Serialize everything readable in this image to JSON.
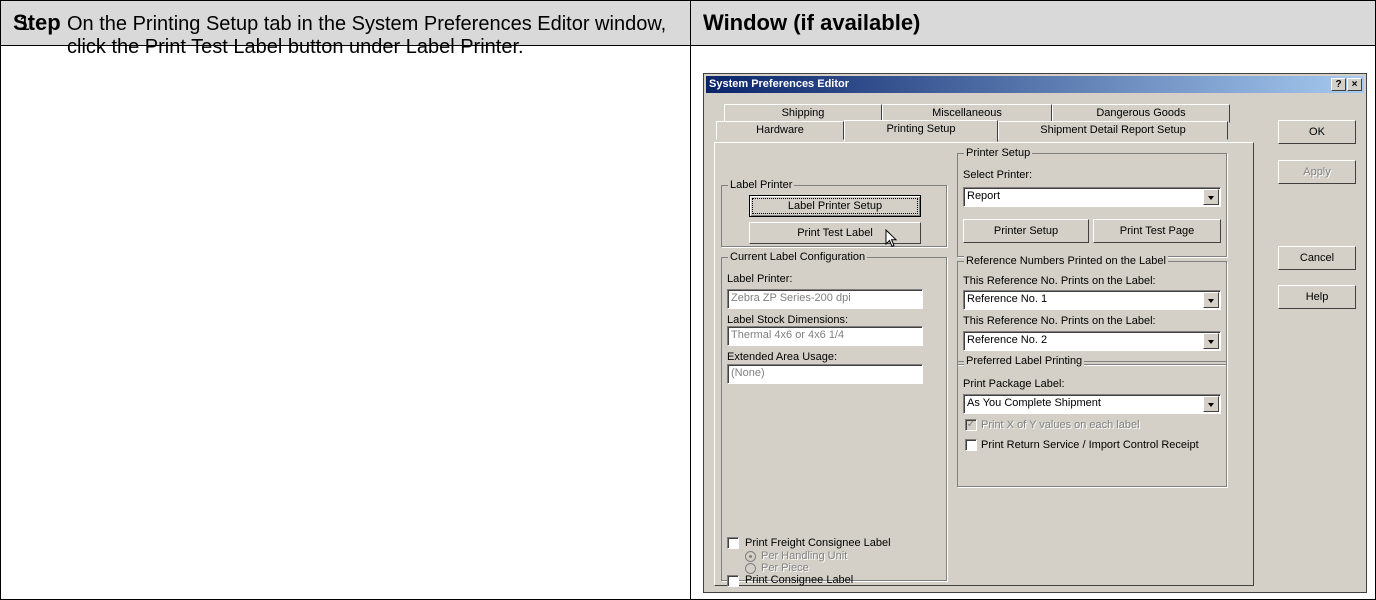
{
  "table": {
    "header_step": "Step",
    "header_window": "Window (if available)",
    "step_number": "1.",
    "step_text": "On the Printing Setup tab in the System Preferences Editor window, click the Print Test Label button under Label Printer."
  },
  "dialog": {
    "title": "System Preferences Editor",
    "help_btn": "?",
    "close_btn": "×",
    "tabs_row1": [
      "Shipping",
      "Miscellaneous",
      "Dangerous Goods"
    ],
    "tabs_row2": [
      "Hardware",
      "Printing Setup",
      "Shipment Detail Report Setup"
    ],
    "active_tab": "Printing Setup",
    "side_buttons": {
      "ok": "OK",
      "apply": "Apply",
      "cancel": "Cancel",
      "help": "Help"
    },
    "label_printer": {
      "group": "Label Printer",
      "setup_btn": "Label Printer Setup",
      "test_btn": "Print Test Label"
    },
    "current_config": {
      "group": "Current Label Configuration",
      "printer_label": "Label Printer:",
      "printer_value": "Zebra  ZP Series-200 dpi",
      "stock_label": "Label Stock Dimensions:",
      "stock_value": "Thermal 4x6 or 4x6 1/4",
      "extended_label": "Extended Area Usage:",
      "extended_value": "(None)",
      "freight_label": "Print Freight Consignee Label",
      "per_unit": "Per Handling Unit",
      "per_piece": "Per Piece",
      "consignee_label": "Print Consignee Label"
    },
    "printer_setup": {
      "group": "Printer Setup",
      "select_label": "Select Printer:",
      "select_value": "Report",
      "setup_btn": "Printer Setup",
      "test_page_btn": "Print Test Page"
    },
    "reference": {
      "group": "Reference Numbers Printed on the Label",
      "ref1_label": "This Reference No. Prints on the Label:",
      "ref1_value": "Reference No. 1",
      "ref2_label": "This Reference No. Prints on the Label:",
      "ref2_value": "Reference No. 2"
    },
    "preferred": {
      "group": "Preferred Label Printing",
      "package_label": "Print Package Label:",
      "package_value": "As You Complete Shipment",
      "xofy_label": "Print X of Y values on each label",
      "return_label": "Print Return Service / Import Control Receipt"
    }
  }
}
